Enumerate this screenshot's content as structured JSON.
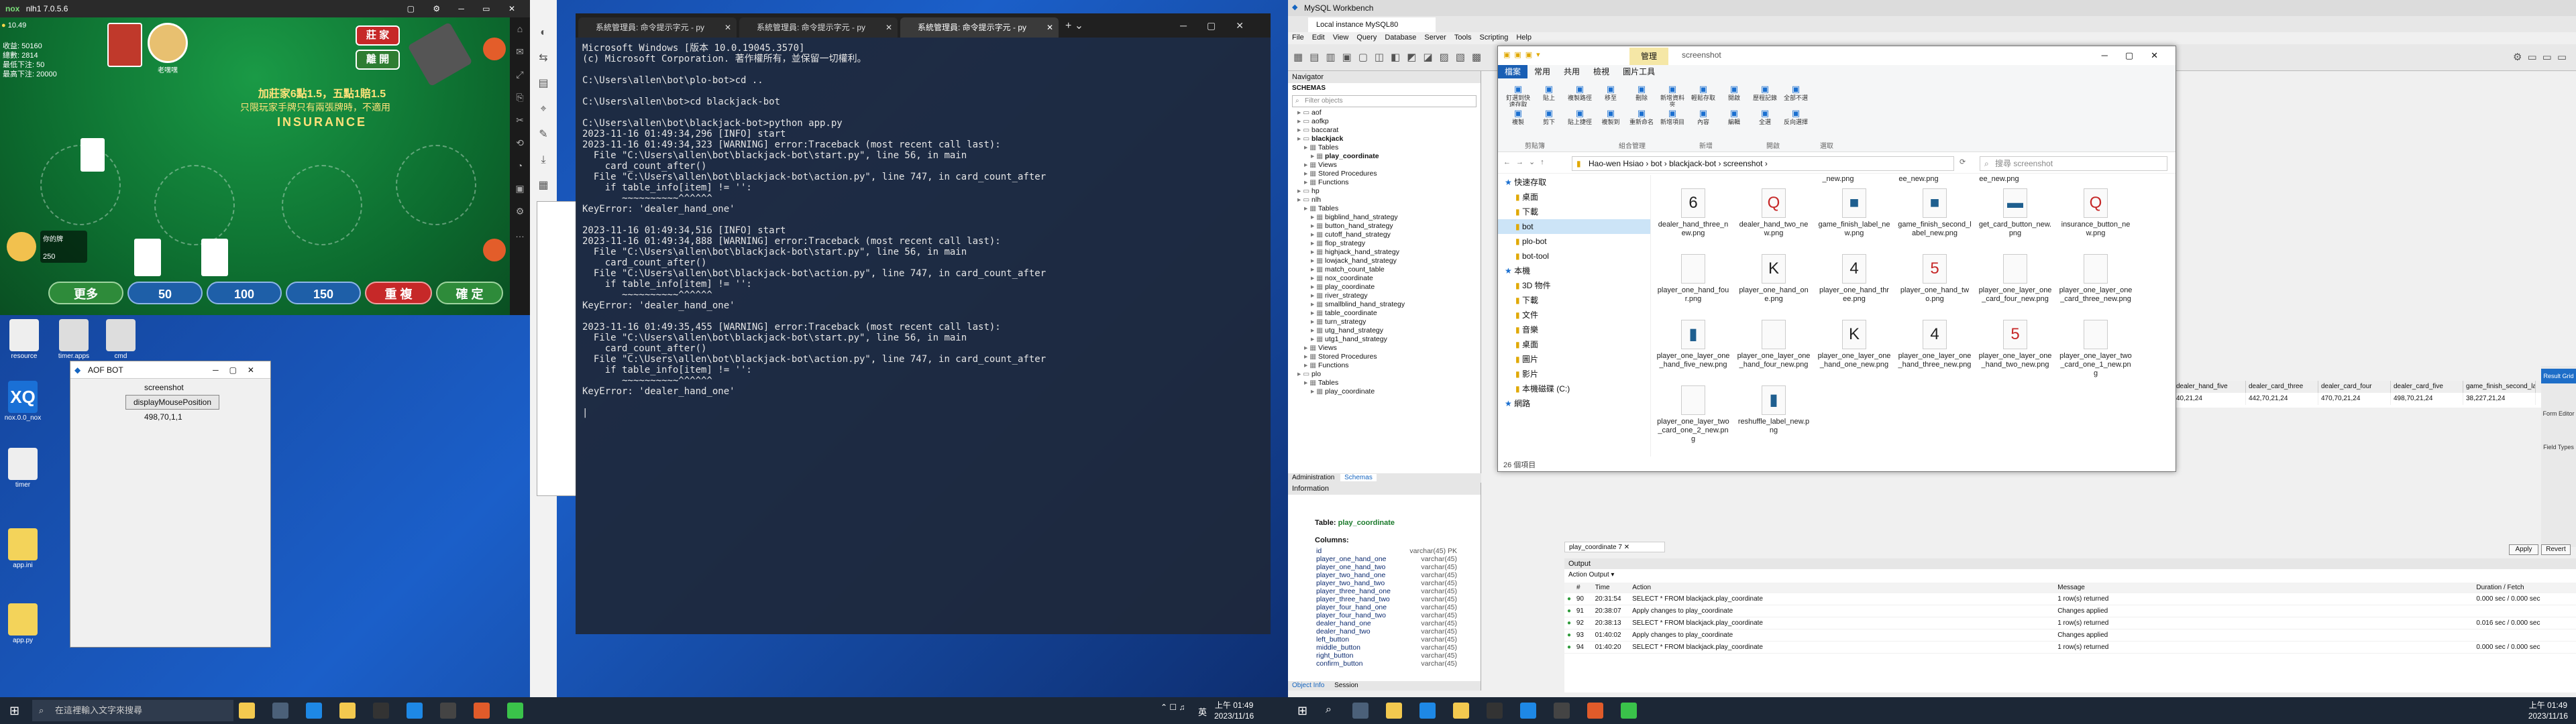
{
  "emulator": {
    "title": "nlh1 7.0.5.6",
    "balance": "10.49",
    "stats": [
      "收益: 50160",
      "總數: 2814",
      "最低下注: 50",
      "最高下注: 20000"
    ],
    "player_name": "老嘿嘿",
    "buttons": {
      "more": "更多",
      "chip1": "50",
      "chip2": "100",
      "chip3": "150",
      "repeat": "重 複",
      "confirm": "確 定",
      "banker": "莊 家",
      "leave": "離 開"
    },
    "table_text_1": "加莊家6點1.5，五點1賠1.5",
    "table_text_2": "只限玩家手牌只有兩張牌時，不適用",
    "insurance": "INSURANCE",
    "player_bet": "250",
    "player_label": "你的牌"
  },
  "desktop_left": {
    "icons": [
      "resource",
      "timer.apps",
      "cmd",
      "nox.0.0_nox",
      "timer",
      "app.ini",
      "app.py"
    ]
  },
  "aof_bot": {
    "title": "AOF BOT",
    "screenshot_label": "screenshot",
    "display_label": "displayMousePosition",
    "position_value": "498,70,1,1"
  },
  "terminal": {
    "tabs": [
      "系統管理員: 命令提示字元 - py",
      "系統管理員: 命令提示字元 - py",
      "系統管理員: 命令提示字元 - py"
    ],
    "lines": [
      "Microsoft Windows [版本 10.0.19045.3570]",
      "(c) Microsoft Corporation. 著作權所有，並保留一切權利。",
      "",
      "C:\\Users\\allen\\bot\\plo-bot>cd ..",
      "",
      "C:\\Users\\allen\\bot>cd blackjack-bot",
      "",
      "C:\\Users\\allen\\bot\\blackjack-bot>python app.py",
      "2023-11-16 01:49:34,296 [INFO] start",
      "2023-11-16 01:49:34,323 [WARNING] error:Traceback (most recent call last):",
      "  File \"C:\\Users\\allen\\bot\\blackjack-bot\\start.py\", line 56, in main",
      "    card_count_after()",
      "  File \"C:\\Users\\allen\\bot\\blackjack-bot\\action.py\", line 747, in card_count_after",
      "    if table_info[item] != '':",
      "       ~~~~~~~~~~^^^^^^",
      "KeyError: 'dealer_hand_one'",
      "",
      "2023-11-16 01:49:34,516 [INFO] start",
      "2023-11-16 01:49:34,888 [WARNING] error:Traceback (most recent call last):",
      "  File \"C:\\Users\\allen\\bot\\blackjack-bot\\start.py\", line 56, in main",
      "    card_count_after()",
      "  File \"C:\\Users\\allen\\bot\\blackjack-bot\\action.py\", line 747, in card_count_after",
      "    if table_info[item] != '':",
      "       ~~~~~~~~~~^^^^^^",
      "KeyError: 'dealer_hand_one'",
      "",
      "2023-11-16 01:49:35,455 [WARNING] error:Traceback (most recent call last):",
      "  File \"C:\\Users\\allen\\bot\\blackjack-bot\\start.py\", line 56, in main",
      "    card_count_after()",
      "  File \"C:\\Users\\allen\\bot\\blackjack-bot\\action.py\", line 747, in card_count_after",
      "    if table_info[item] != '':",
      "       ~~~~~~~~~~^^^^^^",
      "KeyError: 'dealer_hand_one'",
      "",
      "|"
    ]
  },
  "taskbar1": {
    "search_placeholder": "在這裡輸入文字來搜尋",
    "time": "上午 01:49",
    "date": "2023/11/16",
    "ime": "英"
  },
  "taskbar2": {
    "time": "上午 01:49",
    "date": "2023/11/16"
  },
  "workbench": {
    "title": "MySQL Workbench",
    "tab": "Local instance MySQL80",
    "menu": [
      "File",
      "Edit",
      "View",
      "Query",
      "Database",
      "Server",
      "Tools",
      "Scripting",
      "Help"
    ],
    "navigator_title": "Navigator",
    "schemas_title": "SCHEMAS",
    "filter_placeholder": "Filter objects",
    "tree": [
      "aof",
      "aofkp",
      "baccarat",
      "blackjack",
      "Tables",
      "play_coordinate",
      "Views",
      "Stored Procedures",
      "Functions",
      "hp",
      "nlh",
      "Tables",
      "bigblind_hand_strategy",
      "button_hand_strategy",
      "cutoff_hand_strategy",
      "flop_strategy",
      "highjack_hand_strategy",
      "lowjack_hand_strategy",
      "match_count_table",
      "nox_coordinate",
      "play_coordinate",
      "river_strategy",
      "smallblind_hand_strategy",
      "table_coordinate",
      "turn_strategy",
      "utg_hand_strategy",
      "utg1_hand_strategy",
      "Views",
      "Stored Procedures",
      "Functions",
      "plo",
      "Tables",
      "play_coordinate"
    ],
    "nav_tabs": [
      "Administration",
      "Schemas"
    ],
    "info_title": "Information",
    "table_label": "Table:",
    "table_name": "play_coordinate",
    "columns_label": "Columns:",
    "columns": [
      [
        "id",
        "varchar(45) PK"
      ],
      [
        "player_one_hand_one",
        "varchar(45)"
      ],
      [
        "player_one_hand_two",
        "varchar(45)"
      ],
      [
        "player_two_hand_one",
        "varchar(45)"
      ],
      [
        "player_two_hand_two",
        "varchar(45)"
      ],
      [
        "player_three_hand_one",
        "varchar(45)"
      ],
      [
        "player_three_hand_two",
        "varchar(45)"
      ],
      [
        "player_four_hand_one",
        "varchar(45)"
      ],
      [
        "player_four_hand_two",
        "varchar(45)"
      ],
      [
        "dealer_hand_one",
        "varchar(45)"
      ],
      [
        "dealer_hand_two",
        "varchar(45)"
      ],
      [
        "left_button",
        "varchar(45)"
      ],
      [
        "middle_button",
        "varchar(45)"
      ],
      [
        "right_button",
        "varchar(45)"
      ],
      [
        "confirm_button",
        "varchar(45)"
      ]
    ],
    "info_tabs": [
      "Object Info",
      "Session"
    ],
    "result_headers": [
      "dealer_hand_five",
      "dealer_card_three",
      "dealer_card_four",
      "dealer_card_five",
      "game_finish_second_label"
    ],
    "result_row": [
      "40,21,24",
      "442,70,21,24",
      "470,70,21,24",
      "498,70,21,24",
      "38,227,21,24"
    ],
    "query_tab": "play_coordinate 7",
    "output_title": "Output",
    "action_output": "Action Output",
    "output_headers": [
      "#",
      "Time",
      "Action",
      "Message",
      "Duration / Fetch"
    ],
    "output_rows": [
      [
        "90",
        "20:31:54",
        "SELECT * FROM blackjack.play_coordinate",
        "1 row(s) returned",
        "0.000 sec / 0.000 sec"
      ],
      [
        "91",
        "20:38:07",
        "Apply changes to play_coordinate",
        "Changes applied",
        ""
      ],
      [
        "92",
        "20:38:13",
        "SELECT * FROM blackjack.play_coordinate",
        "1 row(s) returned",
        "0.016 sec / 0.000 sec"
      ],
      [
        "93",
        "01:40:02",
        "Apply changes to play_coordinate",
        "Changes applied",
        ""
      ],
      [
        "94",
        "01:40:20",
        "SELECT * FROM blackjack.play_coordinate",
        "1 row(s) returned",
        "0.000 sec / 0.000 sec"
      ]
    ],
    "apply_label": "Apply",
    "revert_label": "Revert",
    "side_labels": [
      "Result Grid",
      "Form Editor",
      "Field Types"
    ]
  },
  "explorer": {
    "ribbon_tabs": [
      "檔案",
      "常用",
      "共用",
      "檢視",
      "圖片工具"
    ],
    "manage_tab": "管理",
    "window_title": "screenshot",
    "path": [
      "Hao-wen Hsiao",
      "bot",
      "blackjack-bot",
      "screenshot"
    ],
    "search_placeholder": "搜尋 screenshot",
    "ribbon_groups": [
      "剪貼簿",
      "組合管理",
      "新增",
      "開啟",
      "選取"
    ],
    "ribbon_buttons": [
      "釘選到快速存取",
      "複製",
      "貼上",
      "剪下",
      "複製路徑",
      "貼上捷徑",
      "移至",
      "複製到",
      "刪除",
      "重新命名",
      "新增資料夾",
      "新增項目",
      "輕鬆存取",
      "內容",
      "開啟",
      "編輯",
      "歷程記錄",
      "全選",
      "全部不選",
      "反向選擇"
    ],
    "tree": [
      "快速存取",
      "桌面",
      "下載",
      "bot",
      "plo-bot",
      "bot-tool",
      "本機",
      "3D 物件",
      "下載",
      "文件",
      "音樂",
      "桌面",
      "圖片",
      "影片",
      "本機磁碟 (C:)",
      "網路"
    ],
    "files": [
      {
        "name": "dealer_hand_three_new.png",
        "glyph": "6"
      },
      {
        "name": "dealer_hand_two_new.png",
        "glyph": "Q"
      },
      {
        "name": "game_finish_label_new.png",
        "glyph": "■"
      },
      {
        "name": "game_finish_second_label_new.png",
        "glyph": "■"
      },
      {
        "name": "get_card_button_new.png",
        "glyph": "▬"
      },
      {
        "name": "insurance_button_new.png",
        "glyph": "Q"
      },
      {
        "name": "player_one_hand_four.png",
        "glyph": " "
      },
      {
        "name": "player_one_hand_one.png",
        "glyph": "K"
      },
      {
        "name": "player_one_hand_three.png",
        "glyph": "4"
      },
      {
        "name": "player_one_hand_two.png",
        "glyph": "5"
      },
      {
        "name": "player_one_layer_one_card_four_new.png",
        "glyph": " "
      },
      {
        "name": "player_one_layer_one_card_three_new.png",
        "glyph": " "
      },
      {
        "name": "player_one_layer_one_hand_five_new.png",
        "glyph": "▮"
      },
      {
        "name": "player_one_layer_one_hand_four_new.png",
        "glyph": " "
      },
      {
        "name": "player_one_layer_one_hand_one_new.png",
        "glyph": "K"
      },
      {
        "name": "player_one_layer_one_hand_three_new.png",
        "glyph": "4"
      },
      {
        "name": "player_one_layer_one_hand_two_new.png",
        "glyph": "5"
      },
      {
        "name": "player_one_layer_two_card_one_1_new.png",
        "glyph": " "
      },
      {
        "name": "player_one_layer_two_card_one_2_new.png",
        "glyph": " "
      },
      {
        "name": "reshuffle_label_new.png",
        "glyph": "▮"
      }
    ],
    "top_partial": [
      "_new.png",
      "ee_new.png",
      "ee_new.png"
    ],
    "status": "26 個項目"
  }
}
